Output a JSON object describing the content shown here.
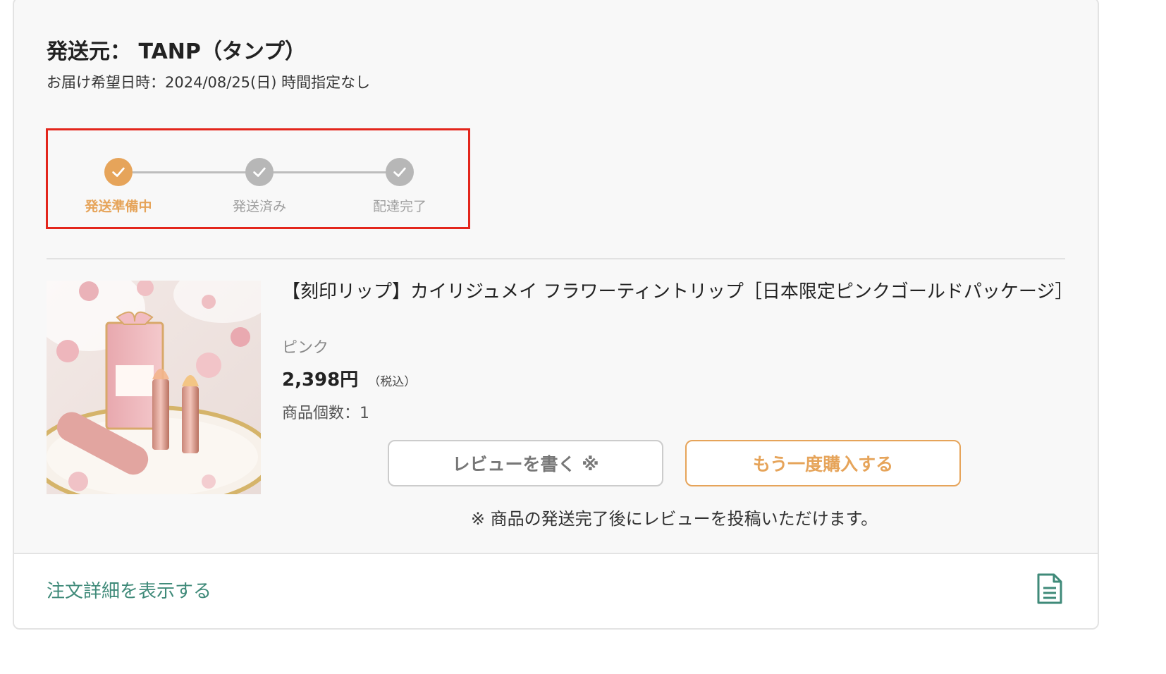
{
  "shipment": {
    "shipper_title": "発送元： TANP（タンプ）",
    "delivery_date": "お届け希望日時：2024/08/25(日) 時間指定なし"
  },
  "progress": {
    "current_step": 1,
    "steps": [
      {
        "label": "発送準備中",
        "state": "active"
      },
      {
        "label": "発送済み",
        "state": "inactive"
      },
      {
        "label": "配達完了",
        "state": "inactive"
      }
    ],
    "colors": {
      "active": "#e6a45a",
      "inactive": "#b7b7b7",
      "highlight_border": "#e3261c"
    }
  },
  "product": {
    "image_icon": "product-photo-lipstick",
    "title": "【刻印リップ】カイリジュメイ フラワーティントリップ［日本限定ピンクゴールドパッケージ］",
    "variant": "ピンク",
    "price": "2,398円",
    "tax_note": "（税込）",
    "quantity": "商品個数：1"
  },
  "actions": {
    "review_label": "レビューを書く ※",
    "rebuy_label": "もう一度購入する",
    "review_note": "※ 商品の発送完了後にレビューを投稿いただけます。"
  },
  "footer": {
    "order_detail_label": "注文詳細を表示する",
    "order_detail_icon": "document-icon",
    "link_color": "#3f8a79"
  }
}
